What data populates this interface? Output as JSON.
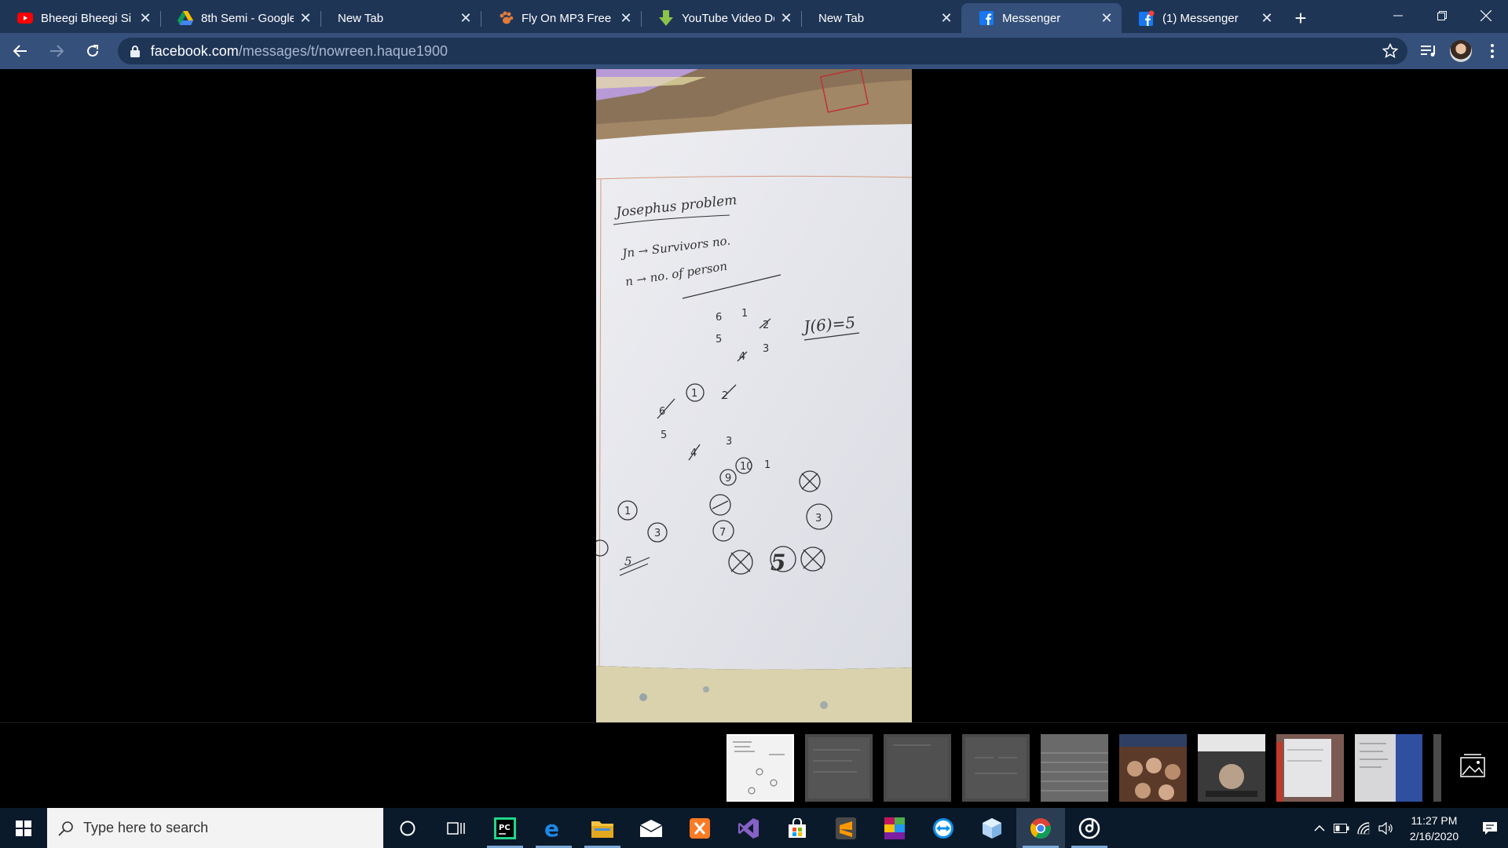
{
  "browser": {
    "tabs": [
      {
        "title": "Bheegi Bheegi Si H",
        "favicon": "youtube-icon"
      },
      {
        "title": "8th Semi - Google",
        "favicon": "google-drive-icon"
      },
      {
        "title": "New Tab",
        "favicon": "none"
      },
      {
        "title": "Fly On MP3 Free D",
        "favicon": "paw-icon"
      },
      {
        "title": "YouTube Video Do",
        "favicon": "download-arrow-icon"
      },
      {
        "title": "New Tab",
        "favicon": "none"
      },
      {
        "title": "Messenger",
        "favicon": "facebook-icon"
      },
      {
        "title": "(1) Messenger",
        "favicon": "facebook-notification-icon"
      }
    ],
    "active_tab_index": 6,
    "url_host": "facebook.com",
    "url_path": "/messages/t/nowreen.haque1900"
  },
  "photo_notes": {
    "title": "Josephus problem",
    "line1": "Jn → Survivors no.",
    "line2": "n → no. of person",
    "result": "J(6)=5",
    "answer": "5",
    "mark_5": "5"
  },
  "taskbar": {
    "search_placeholder": "Type here to search",
    "time": "11:27 PM",
    "date": "2/16/2020"
  },
  "colors": {
    "tab_strip": "#1f3556",
    "toolbar": "#35507a",
    "accent": "#7aa6d6"
  }
}
